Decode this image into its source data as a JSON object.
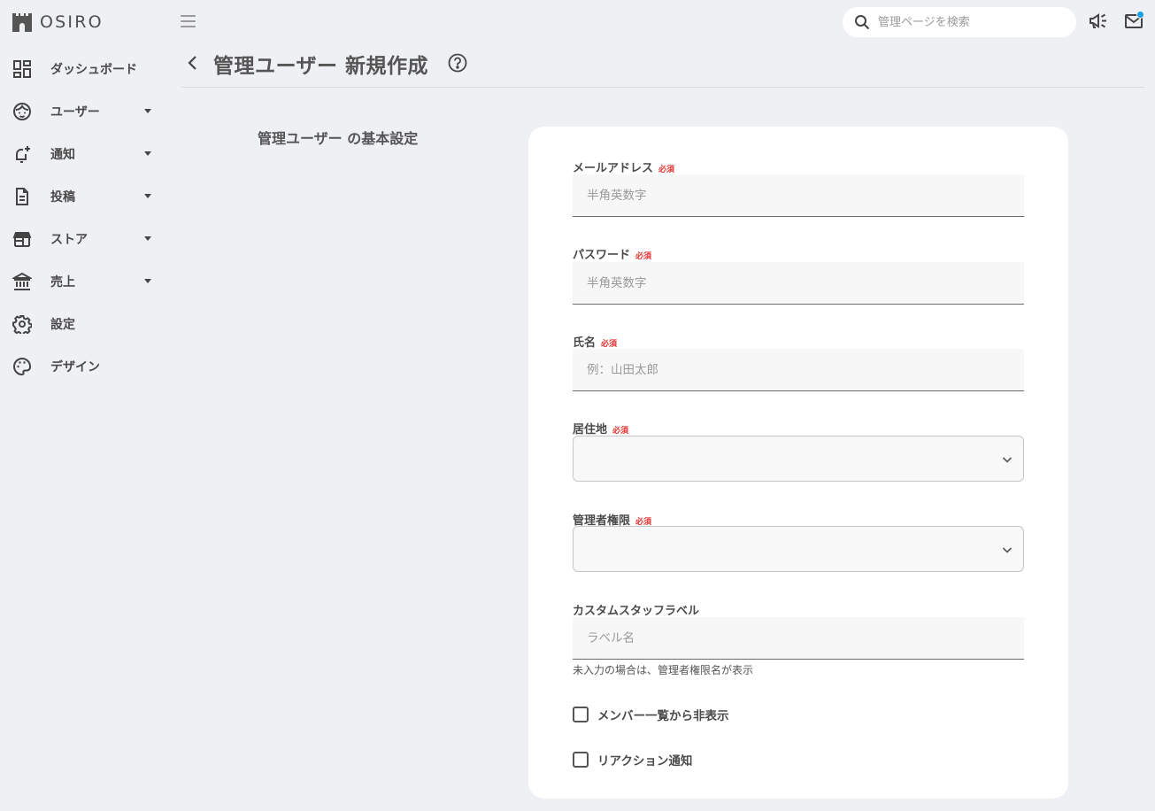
{
  "app": {
    "logo_text": "OSIRO"
  },
  "sidebar": {
    "items": [
      {
        "label": "ダッシュボード",
        "icon": "dashboard-icon",
        "has_submenu": false
      },
      {
        "label": "ユーザー",
        "icon": "face-icon",
        "has_submenu": true
      },
      {
        "label": "通知",
        "icon": "bell-add-icon",
        "has_submenu": true
      },
      {
        "label": "投稿",
        "icon": "document-icon",
        "has_submenu": true
      },
      {
        "label": "ストア",
        "icon": "store-icon",
        "has_submenu": true
      },
      {
        "label": "売上",
        "icon": "bank-icon",
        "has_submenu": true
      },
      {
        "label": "設定",
        "icon": "gear-icon",
        "has_submenu": false
      },
      {
        "label": "デザイン",
        "icon": "palette-icon",
        "has_submenu": false
      }
    ]
  },
  "topbar": {
    "search_placeholder": "管理ページを検索",
    "announcement_icon": "megaphone-icon",
    "mail_icon": "mail-icon",
    "mail_has_unread": true,
    "unread_dot_color": "#1aa0e6"
  },
  "page": {
    "title": "管理ユーザー 新規作成",
    "section_title": "管理ユーザー の基本設定"
  },
  "form": {
    "required_label": "必須",
    "email": {
      "label": "メールアドレス",
      "placeholder": "半角英数字",
      "value": "",
      "required": true
    },
    "password": {
      "label": "パスワード",
      "placeholder": "半角英数字",
      "value": "",
      "required": true
    },
    "name": {
      "label": "氏名",
      "placeholder": "例：山田太郎",
      "value": "",
      "required": true
    },
    "residence": {
      "label": "居住地",
      "value": "",
      "required": true
    },
    "permission": {
      "label": "管理者権限",
      "value": "",
      "required": true
    },
    "custom_label": {
      "label": "カスタムスタッフラベル",
      "placeholder": "ラベル名",
      "value": "",
      "hint": "未入力の場合は、管理者権限名が表示"
    },
    "hide_from_members": {
      "label": "メンバー一覧から非表示",
      "checked": false
    },
    "reaction_notify": {
      "label": "リアクション通知",
      "checked": false
    }
  },
  "colors": {
    "background": "#eef0f4",
    "card": "#ffffff",
    "required": "#e0322f",
    "text": "#4a4a4a"
  }
}
